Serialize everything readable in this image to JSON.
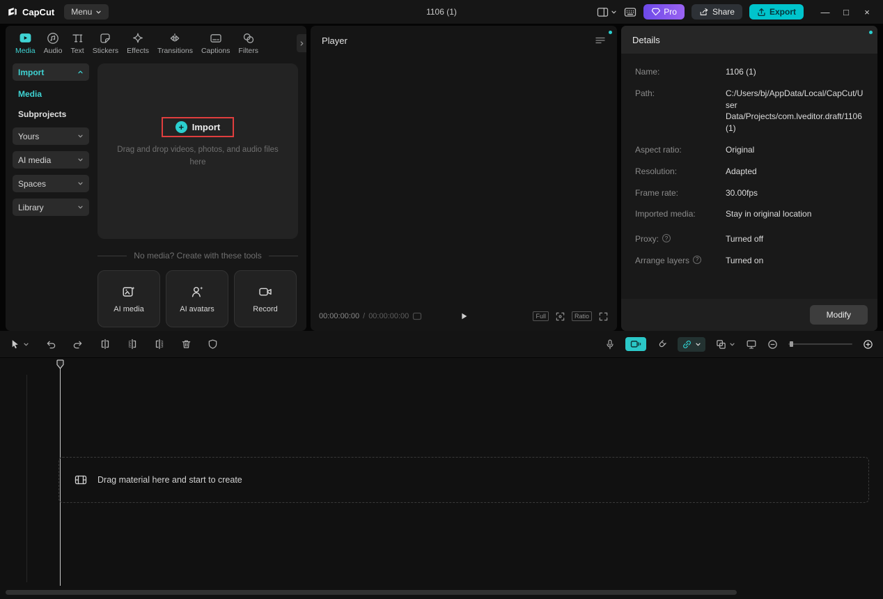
{
  "colors": {
    "accent": "#3fd3d3",
    "export_bg": "#00c4cc",
    "pro_purple": "#7d53f3",
    "annotation_red": "#e03e3e"
  },
  "titlebar": {
    "app_name": "CapCut",
    "menu_label": "Menu",
    "project_title": "1106 (1)",
    "pro_label": "Pro",
    "share_label": "Share",
    "export_label": "Export",
    "minimize_glyph": "—",
    "maximize_glyph": "□",
    "close_glyph": "×"
  },
  "media_panel": {
    "tabs": [
      {
        "label": "Media",
        "icon": "media-icon",
        "active": true
      },
      {
        "label": "Audio",
        "icon": "audio-icon"
      },
      {
        "label": "Text",
        "icon": "text-icon"
      },
      {
        "label": "Stickers",
        "icon": "sticker-icon"
      },
      {
        "label": "Effects",
        "icon": "effects-icon"
      },
      {
        "label": "Transitions",
        "icon": "transitions-icon"
      },
      {
        "label": "Captions",
        "icon": "captions-icon"
      },
      {
        "label": "Filters",
        "icon": "filters-icon"
      }
    ],
    "sidebar": {
      "import_label": "Import",
      "media_label": "Media",
      "subprojects_label": "Subprojects",
      "yours_label": "Yours",
      "ai_media_label": "AI media",
      "spaces_label": "Spaces",
      "library_label": "Library"
    },
    "import_area": {
      "button_label": "Import",
      "hint": "Drag and drop videos, photos, and audio files here"
    },
    "tools_divider": "No media? Create with these tools",
    "tools": [
      {
        "label": "AI media",
        "icon": "ai-media-icon"
      },
      {
        "label": "AI avatars",
        "icon": "ai-avatars-icon"
      },
      {
        "label": "Record",
        "icon": "record-icon"
      }
    ]
  },
  "player": {
    "title": "Player",
    "time_current": "00:00:00:00",
    "time_separator": "/",
    "time_total": "00:00:00:00",
    "full_label": "Full",
    "ratio_label": "Ratio"
  },
  "details": {
    "title": "Details",
    "fields": [
      {
        "label": "Name:",
        "value": "1106 (1)"
      },
      {
        "label": "Path:",
        "value": "C:/Users/bj/AppData/Local/CapCut/User Data/Projects/com.lveditor.draft/1106 (1)"
      },
      {
        "label": "Aspect ratio:",
        "value": "Original"
      },
      {
        "label": "Resolution:",
        "value": "Adapted"
      },
      {
        "label": "Frame rate:",
        "value": "30.00fps"
      },
      {
        "label": "Imported media:",
        "value": "Stay in original location"
      },
      {
        "label": "Proxy:",
        "value": "Turned off",
        "info": true
      },
      {
        "label": "Arrange layers",
        "value": "Turned on",
        "info": true
      }
    ],
    "info_glyph": "?",
    "modify_label": "Modify"
  },
  "timeline": {
    "empty_hint": "Drag material here and start to create"
  }
}
